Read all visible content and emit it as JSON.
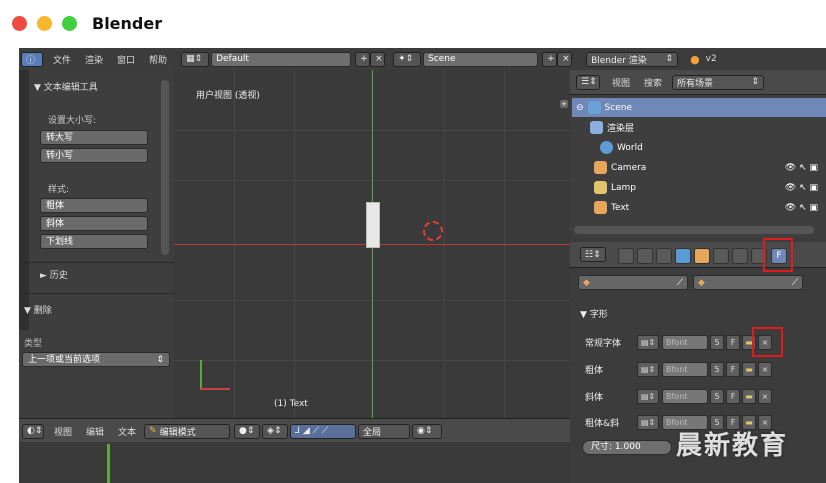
{
  "window": {
    "title": "Blender"
  },
  "topbar": {
    "menus": [
      "文件",
      "渲染",
      "窗口",
      "帮助"
    ],
    "layout": "Default",
    "scene": "Scene",
    "engine": "Blender 渲染",
    "version": "v2"
  },
  "tool_panel": {
    "header": "▼ 文本编辑工具",
    "case_label": "设置大小写:",
    "case_buttons": [
      "转大写",
      "转小写"
    ],
    "style_label": "样式:",
    "style_buttons": [
      "粗体",
      "斜体",
      "下划线"
    ],
    "history": "► 历史",
    "delete_header": "▼ 删除",
    "type_label": "类型",
    "type_value": "上一项或当前选项"
  },
  "viewport": {
    "label": "用户视图 (透视)",
    "object": "(1) Text"
  },
  "bottombar": {
    "menus": [
      "视图",
      "编辑",
      "文本"
    ],
    "mode": "编辑模式",
    "global": "全局"
  },
  "outliner": {
    "menus": [
      "视图",
      "搜索"
    ],
    "filter": "所有场景",
    "items": [
      "Scene",
      "渲染层",
      "World",
      "Camera",
      "Lamp",
      "Text"
    ]
  },
  "properties": {
    "section": "▼ 字形",
    "font_rows": [
      {
        "label": "常规字体",
        "font": "Bfont",
        "num": "5"
      },
      {
        "label": "粗体",
        "font": "Bfont",
        "num": "5"
      },
      {
        "label": "斜体",
        "font": "Bfont",
        "num": "5"
      },
      {
        "label": "粗体&斜",
        "font": "Bfont",
        "num": "5"
      }
    ],
    "size_label": "尺寸:",
    "size_value": "1.000"
  },
  "watermark": "晨新教育",
  "colors": {
    "highlight": "#e01b1b",
    "selection": "#6f88b8",
    "x_axis": "#b53a3a",
    "y_axis": "#5fa63b"
  }
}
